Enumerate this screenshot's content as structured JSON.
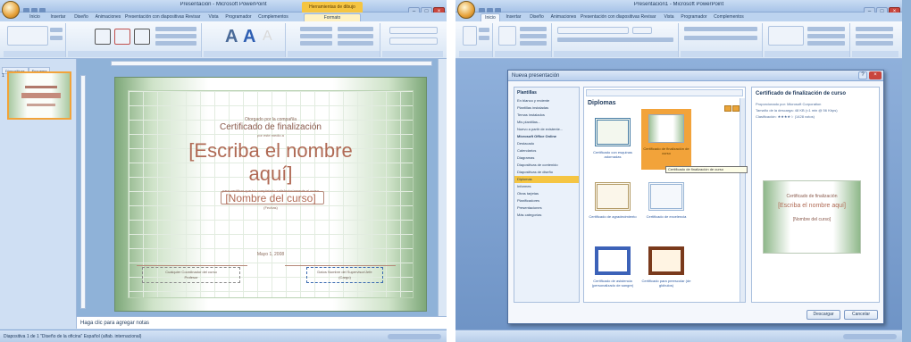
{
  "colors": {
    "accent": "#f2a33a",
    "ribbon": "#d9e6f5",
    "slide_text": "#b06a55"
  },
  "left": {
    "window_title": "Presentación - Microsoft PowerPoint",
    "contextual_tab": "Herramientas de dibujo",
    "tabs": [
      "Inicio",
      "Insertar",
      "Diseño",
      "Animaciones",
      "Presentación con diapositivas",
      "Revisar",
      "Vista",
      "Programador",
      "Complementos",
      "Formato"
    ],
    "thumb_tabs": [
      "Diapositivas",
      "Esquema"
    ],
    "slide_number": "1",
    "certificate": {
      "presented_by": "Otorgado por la compañía",
      "title": "Certificado de finalización",
      "granted_to": "por este medio a",
      "name_line1": "[Escriba el nombre",
      "name_line2": "aquí]",
      "completion_text": "para certificar que ha completado satisfactoriamente el curso",
      "course": "[Nombre del curso]",
      "course_dates": "(Fechas)",
      "date": "Mayo 1, 2008",
      "sig_left": "Cualquier Coordinador del curso",
      "sig_left_role": "Profesor",
      "sig_right": "Datos Nombre del Supervisor/Jefe",
      "sig_right_role": "(Cargo)"
    },
    "notes_placeholder": "Haga clic para agregar notas",
    "status": "Diapositiva 1 de 1   \"Diseño de la oficina\"   Español (alfab. internacional)"
  },
  "right": {
    "window_title": "Presentación1 - Microsoft PowerPoint",
    "tabs": [
      "Inicio",
      "Insertar",
      "Diseño",
      "Animaciones",
      "Presentación con diapositivas",
      "Revisar",
      "Vista",
      "Programador",
      "Complementos"
    ],
    "dialog": {
      "title": "Nueva presentación",
      "nav_head": "Plantillas",
      "nav_items": [
        "En blanco y reciente",
        "Plantillas instaladas",
        "Temas instalados",
        "Mis plantillas...",
        "Nuevo a partir de existente...",
        "Microsoft Office Online",
        "Destacado",
        "Calendarios",
        "Diagramas",
        "Diapositivas de contenido",
        "Diapositivas de diseño",
        "Diplomas",
        "Informes",
        "Otras tarjetas",
        "Planificadores",
        "Presentaciones",
        "Más categorías"
      ],
      "selected_nav": "Diplomas",
      "category_title": "Diplomas",
      "items": [
        {
          "caption": "Certificado con esquinas adornadas"
        },
        {
          "caption": "Certificado de finalización de curso"
        },
        {
          "caption": "Certificado de agradecimiento"
        },
        {
          "caption": "Certificado de excelencia"
        },
        {
          "caption": "Certificado de asistencia (personalizado de sangre)"
        },
        {
          "caption": "Certificado para preescolar (de glóbulos)"
        }
      ],
      "tooltip": "Certificado de finalización de curso",
      "preview_title": "Certificado de finalización de curso",
      "preview_lines": [
        "Proporcionado por: Microsoft Corporation",
        "Tamaño de la descarga: 48 KB (<1 min @ 56 Kbps)",
        "Clasificación: ★★★★☆ (1428 votos)"
      ],
      "preview_cert": {
        "title": "Certificado de finalización",
        "name": "[Escriba el nombre aquí]",
        "course": "[Nombre del curso]"
      },
      "download_btn": "Descargar",
      "cancel_btn": "Cancelar"
    },
    "status": ""
  }
}
